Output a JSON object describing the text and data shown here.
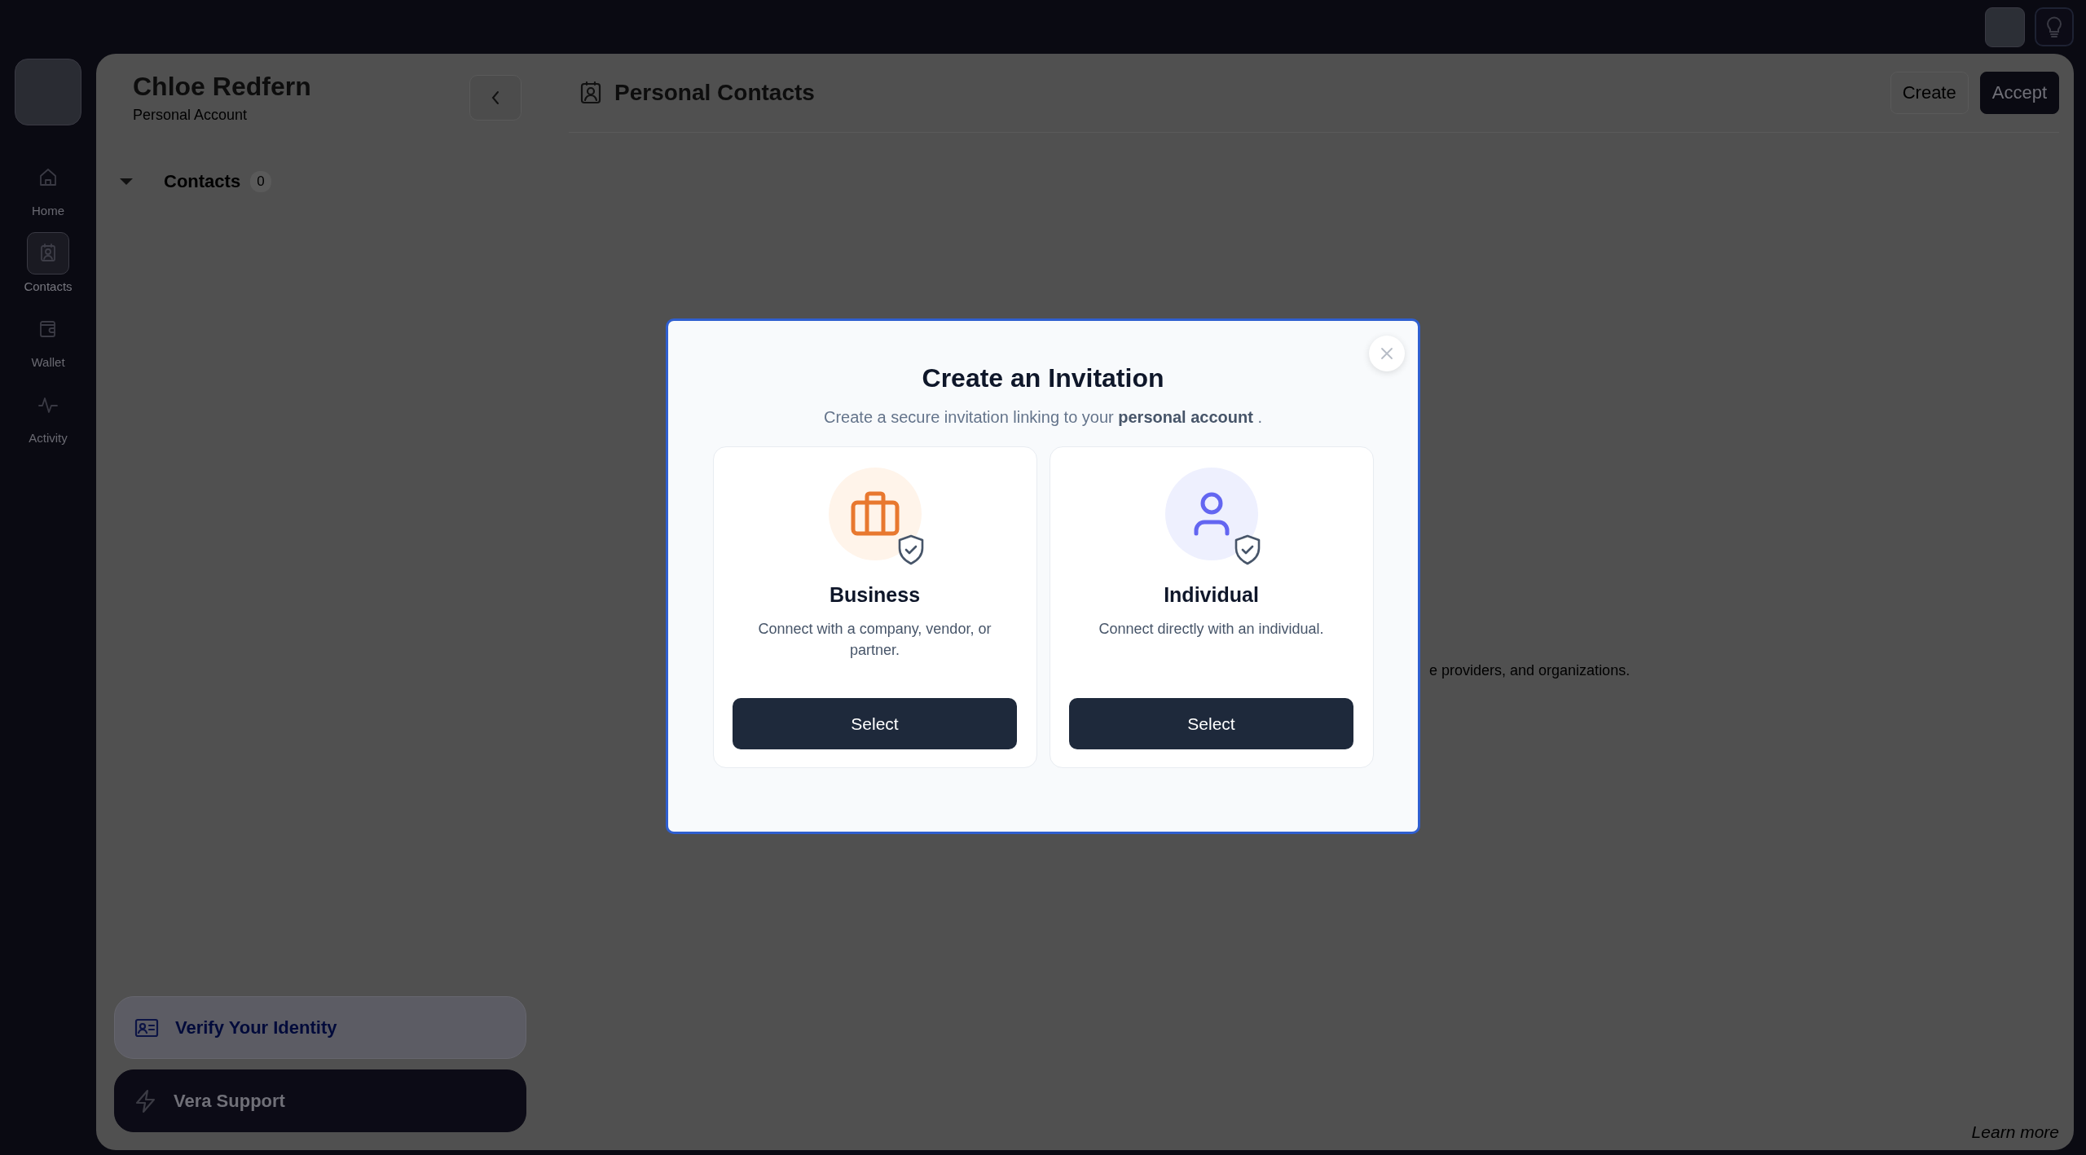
{
  "rail": {
    "items": [
      {
        "label": "Home",
        "selected": false
      },
      {
        "label": "Contacts",
        "selected": true
      },
      {
        "label": "Wallet",
        "selected": false
      },
      {
        "label": "Activity",
        "selected": false
      }
    ]
  },
  "account": {
    "name": "Chloe Redfern",
    "subtitle": "Personal Account"
  },
  "contacts_group": {
    "label": "Contacts",
    "count": "0",
    "expanded": true
  },
  "bottom_actions": [
    {
      "kind": "verify",
      "label": "Verify Your Identity"
    },
    {
      "kind": "support",
      "label": "Vera Support"
    }
  ],
  "header": {
    "title": "Personal Contacts",
    "buttons": [
      {
        "kind": "outline",
        "label": "Create"
      },
      {
        "kind": "primary",
        "label": "Accept"
      }
    ]
  },
  "empty_state_fragment": "e providers, and organizations.",
  "footer_link": "Learn more",
  "modal": {
    "title": "Create an Invitation",
    "subtitle": "Create a secure invitation linking to your **personal account** .",
    "options": [
      {
        "kind": "business",
        "title": "Business",
        "description": "Connect with a company, vendor, or partner.",
        "button": "Select"
      },
      {
        "kind": "individual",
        "title": "Individual",
        "description": "Connect directly with an individual.",
        "button": "Select"
      }
    ]
  }
}
